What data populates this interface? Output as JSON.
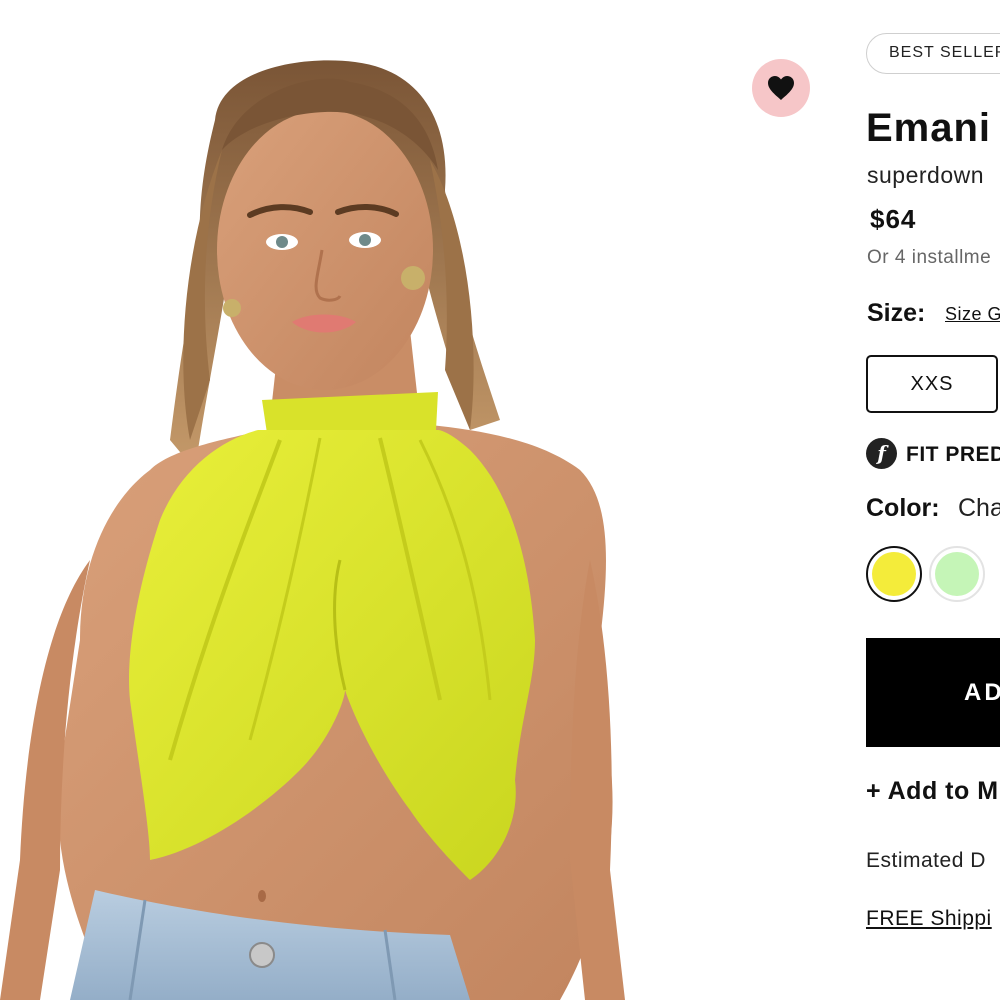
{
  "product": {
    "badge": "BEST SELLER",
    "title": "Emani",
    "brand": "superdown",
    "price": "$64",
    "installments": "Or 4 installme"
  },
  "size": {
    "label": "Size:",
    "guide_link": "Size G",
    "options": [
      "XXS"
    ]
  },
  "fit_predictor": {
    "icon_letter": "f",
    "label": "FIT PRED"
  },
  "color": {
    "label": "Color:",
    "value": "Cha",
    "swatches": [
      {
        "name": "chartreuse",
        "hex": "#f4ec3a",
        "selected": true
      },
      {
        "name": "mint",
        "hex": "#c5f5b7",
        "selected": false
      }
    ]
  },
  "actions": {
    "add_to_bag": "AD",
    "add_to_list": "+ Add to M"
  },
  "delivery": {
    "estimated": "Estimated D",
    "shipping_link": "FREE Shippi"
  },
  "colors": {
    "wishlist_bg": "#f6c6c8",
    "top_yellow": "#e6ec2e",
    "button_black": "#000000"
  },
  "icons": {
    "wishlist": "heart-icon",
    "fit_predictor": "fit-predictor-icon"
  }
}
